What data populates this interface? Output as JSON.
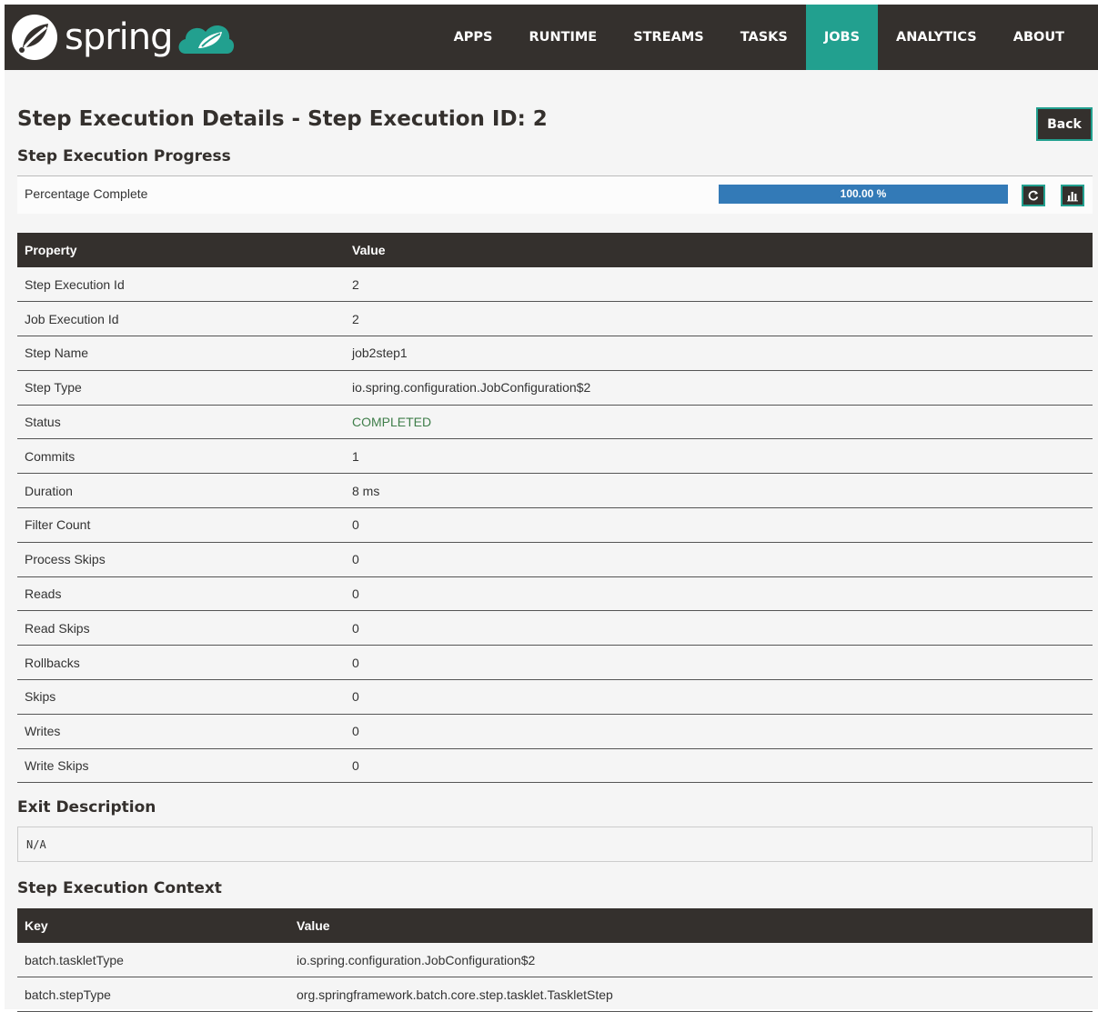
{
  "brand": {
    "name": "spring"
  },
  "nav": {
    "items": [
      {
        "label": "APPS",
        "active": false
      },
      {
        "label": "RUNTIME",
        "active": false
      },
      {
        "label": "STREAMS",
        "active": false
      },
      {
        "label": "TASKS",
        "active": false
      },
      {
        "label": "JOBS",
        "active": true
      },
      {
        "label": "ANALYTICS",
        "active": false
      },
      {
        "label": "ABOUT",
        "active": false
      }
    ]
  },
  "page": {
    "title": "Step Execution Details - Step Execution ID: 2",
    "back_label": "Back"
  },
  "progress": {
    "section_title": "Step Execution Progress",
    "label": "Percentage Complete",
    "percent": 100,
    "percent_text": "100.00 %",
    "refresh_icon": "refresh-icon",
    "chart_icon": "bar-chart-icon"
  },
  "properties": {
    "headers": {
      "property": "Property",
      "value": "Value"
    },
    "rows": [
      {
        "property": "Step Execution Id",
        "value": "2"
      },
      {
        "property": "Job Execution Id",
        "value": "2"
      },
      {
        "property": "Step Name",
        "value": "job2step1"
      },
      {
        "property": "Step Type",
        "value": "io.spring.configuration.JobConfiguration$2"
      },
      {
        "property": "Status",
        "value": "COMPLETED"
      },
      {
        "property": "Commits",
        "value": "1"
      },
      {
        "property": "Duration",
        "value": "8 ms"
      },
      {
        "property": "Filter Count",
        "value": "0"
      },
      {
        "property": "Process Skips",
        "value": "0"
      },
      {
        "property": "Reads",
        "value": "0"
      },
      {
        "property": "Read Skips",
        "value": "0"
      },
      {
        "property": "Rollbacks",
        "value": "0"
      },
      {
        "property": "Skips",
        "value": "0"
      },
      {
        "property": "Writes",
        "value": "0"
      },
      {
        "property": "Write Skips",
        "value": "0"
      }
    ]
  },
  "exit": {
    "section_title": "Exit Description",
    "text": "N/A"
  },
  "context": {
    "section_title": "Step Execution Context",
    "headers": {
      "key": "Key",
      "value": "Value"
    },
    "rows": [
      {
        "key": "batch.taskletType",
        "value": "io.spring.configuration.JobConfiguration$2"
      },
      {
        "key": "batch.stepType",
        "value": "org.springframework.batch.core.step.tasklet.TaskletStep"
      }
    ]
  },
  "colors": {
    "navbar": "#34302d",
    "accent": "#22a08f",
    "progress": "#337ab7",
    "status_completed": "#3f7e4a"
  }
}
